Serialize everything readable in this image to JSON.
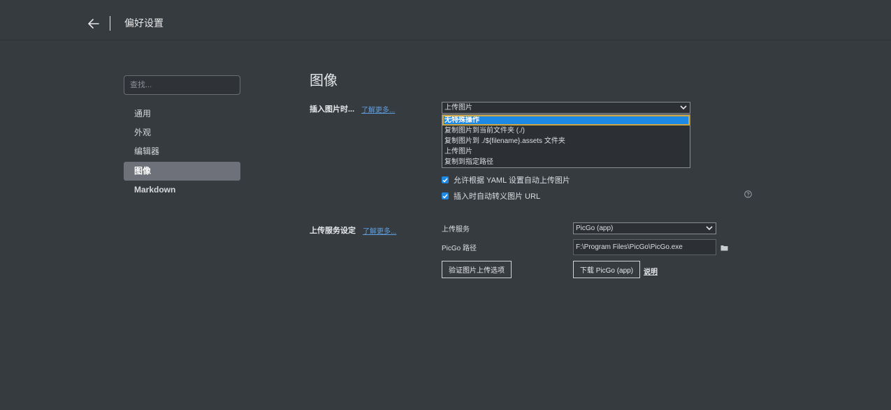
{
  "header": {
    "title": "偏好设置"
  },
  "sidebar": {
    "search_placeholder": "查找...",
    "items": [
      {
        "label": "通用"
      },
      {
        "label": "外观"
      },
      {
        "label": "编辑器"
      },
      {
        "label": "图像",
        "active": true
      },
      {
        "label": "Markdown"
      }
    ]
  },
  "main": {
    "title": "图像",
    "insert": {
      "label": "插入图片时...",
      "learn_more": "了解更多...",
      "selected": "上传图片",
      "options": [
        "无特殊操作",
        "复制图片到当前文件夹 (./)",
        "复制图片到 ./${filename}.assets 文件夹",
        "上传图片",
        "复制到指定路径"
      ],
      "highlighted_option": "无特殊操作"
    },
    "checkboxes": [
      {
        "label": "允许根据 YAML 设置自动上传图片",
        "checked": true
      },
      {
        "label": "插入时自动转义图片 URL",
        "checked": true
      }
    ],
    "upload": {
      "label": "上传服务设定",
      "learn_more": "了解更多...",
      "service_label": "上传服务",
      "service_value": "PicGo (app)",
      "path_label": "PicGo 路径",
      "path_value": "F:\\Program Files\\PicGo\\PicGo.exe",
      "verify_button": "验证图片上传选项",
      "download_button": "下载 PicGo (app)",
      "explain_link": "说明"
    }
  },
  "colors": {
    "background": "#363b40",
    "accent": "#1e88e5",
    "link": "#5f9fe0",
    "active_nav": "#6e717a"
  }
}
